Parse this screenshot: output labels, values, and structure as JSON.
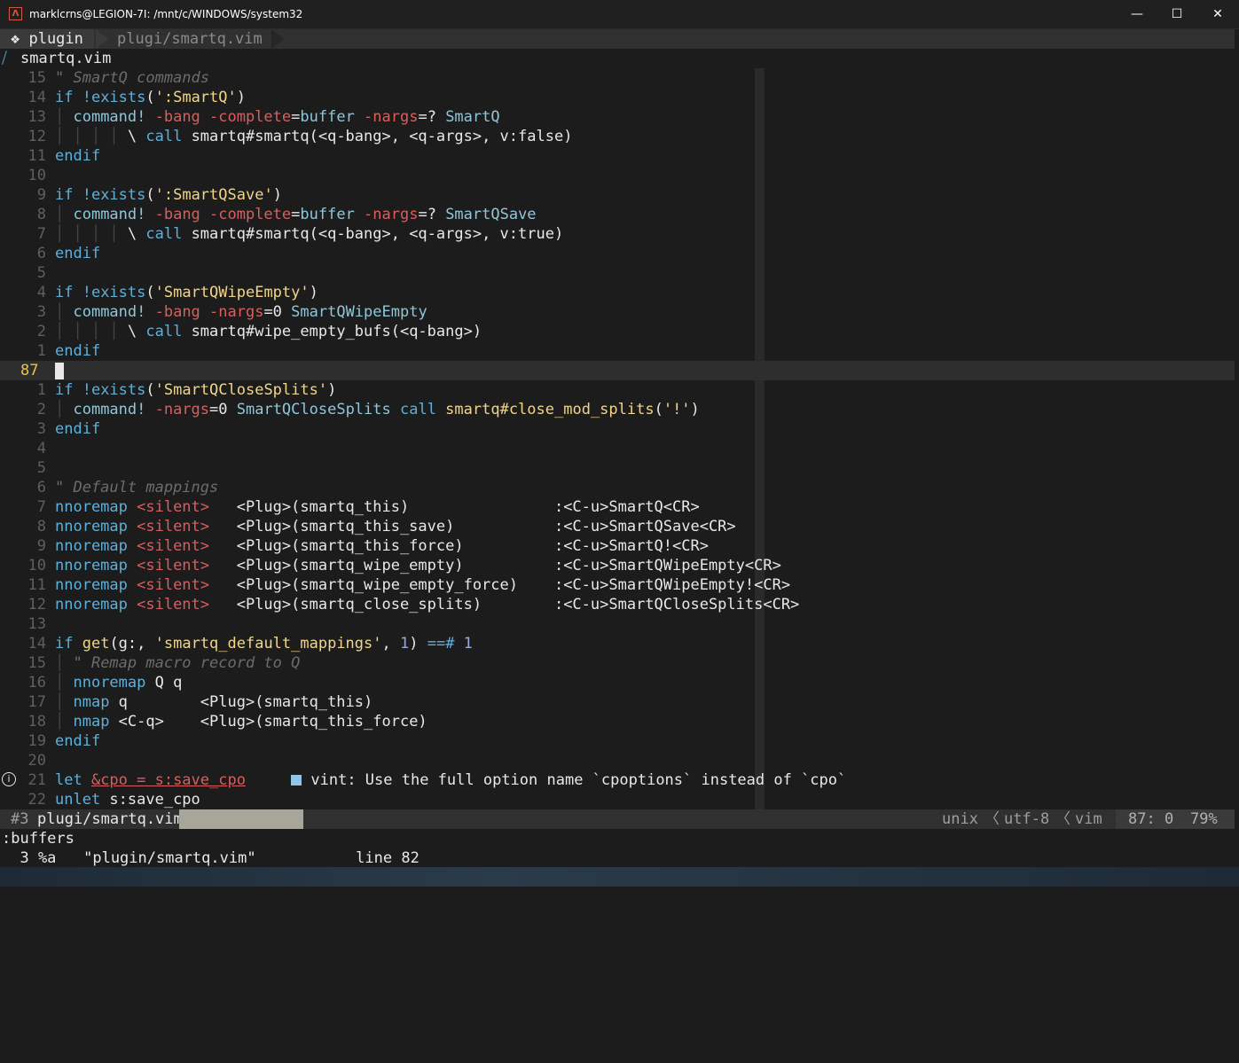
{
  "window": {
    "icon_glyph": "Λ",
    "title": "marklcrns@LEGION-7I: /mnt/c/WINDOWS/system32",
    "minimize": "—",
    "maximize": "☐",
    "close": "✕"
  },
  "tabline": {
    "active_tab": "❖ plugin",
    "inactive_tab": "plugi/smartq.vim"
  },
  "winbar": {
    "mark": "⧸",
    "filename": "smartq.vim"
  },
  "lines": [
    {
      "lnr": "15",
      "segs": [
        {
          "c": "cmt",
          "t": "\" SmartQ commands"
        }
      ]
    },
    {
      "lnr": "14",
      "segs": [
        {
          "c": "kw",
          "t": "if "
        },
        {
          "c": "kw",
          "t": "!exists"
        },
        {
          "c": "plain",
          "t": "("
        },
        {
          "c": "str",
          "t": "':SmartQ'"
        },
        {
          "c": "plain",
          "t": ")"
        }
      ]
    },
    {
      "lnr": "13",
      "segs": [
        {
          "c": "guide",
          "t": "│ "
        },
        {
          "c": "cmd",
          "t": "command! "
        },
        {
          "c": "op",
          "t": "-bang -complete"
        },
        {
          "c": "plain",
          "t": "="
        },
        {
          "c": "cmd",
          "t": "buffer "
        },
        {
          "c": "op",
          "t": "-nargs"
        },
        {
          "c": "plain",
          "t": "=? "
        },
        {
          "c": "cmd",
          "t": "SmartQ"
        }
      ]
    },
    {
      "lnr": "12",
      "segs": [
        {
          "c": "guide",
          "t": "│ │ │ │ "
        },
        {
          "c": "plain",
          "t": "\\ "
        },
        {
          "c": "kw",
          "t": "call "
        },
        {
          "c": "plain",
          "t": "smartq#smartq(<q-bang>, <q-args>, v:false)"
        }
      ]
    },
    {
      "lnr": "11",
      "segs": [
        {
          "c": "kw",
          "t": "endif"
        }
      ]
    },
    {
      "lnr": "10",
      "segs": []
    },
    {
      "lnr": "9",
      "segs": [
        {
          "c": "kw",
          "t": "if "
        },
        {
          "c": "kw",
          "t": "!exists"
        },
        {
          "c": "plain",
          "t": "("
        },
        {
          "c": "str",
          "t": "':SmartQSave'"
        },
        {
          "c": "plain",
          "t": ")"
        }
      ]
    },
    {
      "lnr": "8",
      "segs": [
        {
          "c": "guide",
          "t": "│ "
        },
        {
          "c": "cmd",
          "t": "command! "
        },
        {
          "c": "op",
          "t": "-bang -complete"
        },
        {
          "c": "plain",
          "t": "="
        },
        {
          "c": "cmd",
          "t": "buffer "
        },
        {
          "c": "op",
          "t": "-nargs"
        },
        {
          "c": "plain",
          "t": "=? "
        },
        {
          "c": "cmd",
          "t": "SmartQSave"
        }
      ]
    },
    {
      "lnr": "7",
      "segs": [
        {
          "c": "guide",
          "t": "│ │ │ │ "
        },
        {
          "c": "plain",
          "t": "\\ "
        },
        {
          "c": "kw",
          "t": "call "
        },
        {
          "c": "plain",
          "t": "smartq#smartq(<q-bang>, <q-args>, v:true)"
        }
      ]
    },
    {
      "lnr": "6",
      "segs": [
        {
          "c": "kw",
          "t": "endif"
        }
      ]
    },
    {
      "lnr": "5",
      "segs": []
    },
    {
      "lnr": "4",
      "segs": [
        {
          "c": "kw",
          "t": "if "
        },
        {
          "c": "kw",
          "t": "!exists"
        },
        {
          "c": "plain",
          "t": "("
        },
        {
          "c": "str",
          "t": "'SmartQWipeEmpty'"
        },
        {
          "c": "plain",
          "t": ")"
        }
      ]
    },
    {
      "lnr": "3",
      "segs": [
        {
          "c": "guide",
          "t": "│ "
        },
        {
          "c": "cmd",
          "t": "command! "
        },
        {
          "c": "op",
          "t": "-bang -nargs"
        },
        {
          "c": "plain",
          "t": "=0 "
        },
        {
          "c": "cmd",
          "t": "SmartQWipeEmpty"
        }
      ]
    },
    {
      "lnr": "2",
      "segs": [
        {
          "c": "guide",
          "t": "│ │ │ │ "
        },
        {
          "c": "plain",
          "t": "\\ "
        },
        {
          "c": "kw",
          "t": "call "
        },
        {
          "c": "plain",
          "t": "smartq#wipe_empty_bufs(<q-bang>)"
        }
      ]
    },
    {
      "lnr": "1",
      "segs": [
        {
          "c": "kw",
          "t": "endif"
        }
      ]
    },
    {
      "lnr": "87",
      "current": true,
      "segs": []
    },
    {
      "lnr": "1",
      "segs": [
        {
          "c": "kw",
          "t": "if "
        },
        {
          "c": "kw",
          "t": "!exists"
        },
        {
          "c": "plain",
          "t": "("
        },
        {
          "c": "str",
          "t": "'SmartQCloseSplits'"
        },
        {
          "c": "plain",
          "t": ")"
        }
      ]
    },
    {
      "lnr": "2",
      "segs": [
        {
          "c": "guide",
          "t": "│ "
        },
        {
          "c": "cmd",
          "t": "command! "
        },
        {
          "c": "op",
          "t": "-nargs"
        },
        {
          "c": "plain",
          "t": "=0 "
        },
        {
          "c": "cmd",
          "t": "SmartQCloseSplits "
        },
        {
          "c": "kw",
          "t": "call "
        },
        {
          "c": "fn",
          "t": "smartq#close_mod_splits"
        },
        {
          "c": "plain",
          "t": "("
        },
        {
          "c": "str",
          "t": "'!'"
        },
        {
          "c": "plain",
          "t": ")"
        }
      ]
    },
    {
      "lnr": "3",
      "segs": [
        {
          "c": "kw",
          "t": "endif"
        }
      ]
    },
    {
      "lnr": "4",
      "segs": []
    },
    {
      "lnr": "5",
      "segs": []
    },
    {
      "lnr": "6",
      "segs": [
        {
          "c": "cmt",
          "t": "\" Default mappings"
        }
      ]
    },
    {
      "lnr": "7",
      "segs": [
        {
          "c": "kw",
          "t": "nnoremap "
        },
        {
          "c": "op",
          "t": "<silent>"
        },
        {
          "c": "plain",
          "t": "   <Plug>(smartq_this)                "
        },
        {
          "c": "plain",
          "t": ":<C-u>SmartQ<CR>"
        }
      ]
    },
    {
      "lnr": "8",
      "segs": [
        {
          "c": "kw",
          "t": "nnoremap "
        },
        {
          "c": "op",
          "t": "<silent>"
        },
        {
          "c": "plain",
          "t": "   <Plug>(smartq_this_save)           "
        },
        {
          "c": "plain",
          "t": ":<C-u>SmartQSave<CR>"
        }
      ]
    },
    {
      "lnr": "9",
      "segs": [
        {
          "c": "kw",
          "t": "nnoremap "
        },
        {
          "c": "op",
          "t": "<silent>"
        },
        {
          "c": "plain",
          "t": "   <Plug>(smartq_this_force)          "
        },
        {
          "c": "plain",
          "t": ":<C-u>SmartQ!<CR>"
        }
      ]
    },
    {
      "lnr": "10",
      "segs": [
        {
          "c": "kw",
          "t": "nnoremap "
        },
        {
          "c": "op",
          "t": "<silent>"
        },
        {
          "c": "plain",
          "t": "   <Plug>(smartq_wipe_empty)          "
        },
        {
          "c": "plain",
          "t": ":<C-u>SmartQWipeEmpty<CR>"
        }
      ]
    },
    {
      "lnr": "11",
      "segs": [
        {
          "c": "kw",
          "t": "nnoremap "
        },
        {
          "c": "op",
          "t": "<silent>"
        },
        {
          "c": "plain",
          "t": "   <Plug>(smartq_wipe_empty_force)    "
        },
        {
          "c": "plain",
          "t": ":<C-u>SmartQWipeEmpty!<CR>"
        }
      ]
    },
    {
      "lnr": "12",
      "segs": [
        {
          "c": "kw",
          "t": "nnoremap "
        },
        {
          "c": "op",
          "t": "<silent>"
        },
        {
          "c": "plain",
          "t": "   <Plug>(smartq_close_splits)        "
        },
        {
          "c": "plain",
          "t": ":<C-u>SmartQCloseSplits<CR>"
        }
      ]
    },
    {
      "lnr": "13",
      "segs": []
    },
    {
      "lnr": "14",
      "segs": [
        {
          "c": "kw",
          "t": "if "
        },
        {
          "c": "fn",
          "t": "get"
        },
        {
          "c": "plain",
          "t": "(g:, "
        },
        {
          "c": "str",
          "t": "'smartq_default_mappings'"
        },
        {
          "c": "plain",
          "t": ", "
        },
        {
          "c": "num",
          "t": "1"
        },
        {
          "c": "plain",
          "t": ") "
        },
        {
          "c": "kw",
          "t": "==# "
        },
        {
          "c": "num",
          "t": "1"
        }
      ]
    },
    {
      "lnr": "15",
      "segs": [
        {
          "c": "guide",
          "t": "│ "
        },
        {
          "c": "cmt",
          "t": "\" Remap macro record to Q"
        }
      ]
    },
    {
      "lnr": "16",
      "segs": [
        {
          "c": "guide",
          "t": "│ "
        },
        {
          "c": "kw",
          "t": "nnoremap "
        },
        {
          "c": "plain",
          "t": "Q q"
        }
      ]
    },
    {
      "lnr": "17",
      "segs": [
        {
          "c": "guide",
          "t": "│ "
        },
        {
          "c": "kw",
          "t": "nmap "
        },
        {
          "c": "plain",
          "t": "q        <Plug>(smartq_this)"
        }
      ]
    },
    {
      "lnr": "18",
      "segs": [
        {
          "c": "guide",
          "t": "│ "
        },
        {
          "c": "kw",
          "t": "nmap "
        },
        {
          "c": "plain",
          "t": "<C-q>    <Plug>(smartq_this_force)"
        }
      ]
    },
    {
      "lnr": "19",
      "segs": [
        {
          "c": "kw",
          "t": "endif"
        }
      ]
    },
    {
      "lnr": "20",
      "segs": []
    },
    {
      "lnr": "21",
      "diag": true,
      "segs": [
        {
          "c": "kw",
          "t": "let "
        },
        {
          "c": "op underline",
          "t": "&cpo = s:save_cpo"
        },
        {
          "c": "plain",
          "t": "     "
        },
        {
          "c": "lint",
          "t": ""
        },
        {
          "c": "plain",
          "t": "vint: Use the full option name `cpoptions` instead of `cpo`"
        }
      ]
    },
    {
      "lnr": "22",
      "segs": [
        {
          "c": "kw",
          "t": "unlet "
        },
        {
          "c": "plain",
          "t": "s:save_cpo"
        }
      ]
    }
  ],
  "diagnostic_icon": "i",
  "statusline": {
    "bufnr": "#3",
    "file": "plugi/smartq.vim",
    "fileformat": "unix",
    "sep": "〈",
    "encoding": "utf-8",
    "filetype": "vim",
    "position": "87: 0",
    "percent": "79%"
  },
  "cmdline": {
    "line1": ":buffers",
    "line2": "  3 %a   \"plugin/smartq.vim\"           line 82"
  }
}
